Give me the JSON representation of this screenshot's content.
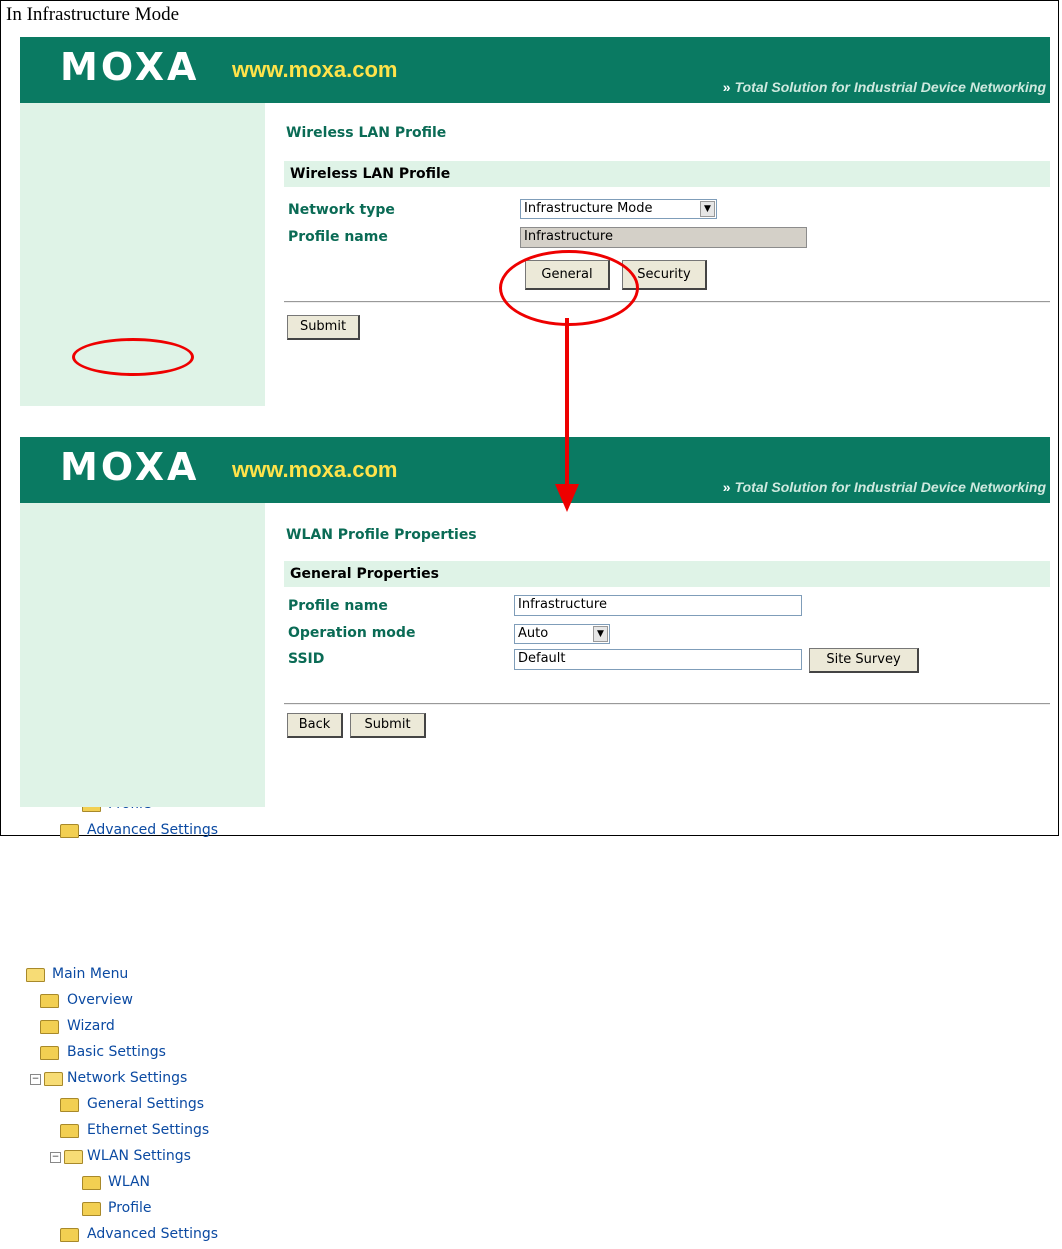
{
  "caption": "In Infrastructure Mode",
  "banner": {
    "logo": "MOXA",
    "website": "www.moxa.com",
    "chevrons": "»",
    "tagline": "Total Solution for Industrial Device Networking"
  },
  "sidebar": {
    "main_menu": "Main Menu",
    "overview": "Overview",
    "wizard": "Wizard",
    "basic_settings": "Basic Settings",
    "network_settings": "Network Settings",
    "general_settings": "General Settings",
    "ethernet_settings": "Ethernet Settings",
    "wlan_settings": "WLAN Settings",
    "wlan": "WLAN",
    "profile": "Profile",
    "advanced_settings": "Advanced Settings",
    "expand_minus": "−"
  },
  "top": {
    "page_title": "Wireless LAN Profile",
    "section": "Wireless LAN Profile",
    "network_type_label": "Network type",
    "network_type_value": "Infrastructure Mode",
    "profile_name_label": "Profile name",
    "profile_name_value": "Infrastructure",
    "general_button": "General",
    "security_button": "Security",
    "submit_button": "Submit"
  },
  "bottom": {
    "page_title": "WLAN Profile Properties",
    "section": "General Properties",
    "profile_name_label": "Profile name",
    "profile_name_value": "Infrastructure",
    "operation_mode_label": "Operation mode",
    "operation_mode_value": "Auto",
    "ssid_label": "SSID",
    "ssid_value": "Default",
    "site_survey_button": "Site Survey",
    "back_button": "Back",
    "submit_button": "Submit"
  },
  "icons": {
    "dropdown": "▼"
  },
  "colors": {
    "banner": "#0a7a62",
    "sidebar": "#dff3e7",
    "annotation": "#e00000",
    "accent_title": "#0a6b55",
    "link": "#0b4aa2"
  }
}
